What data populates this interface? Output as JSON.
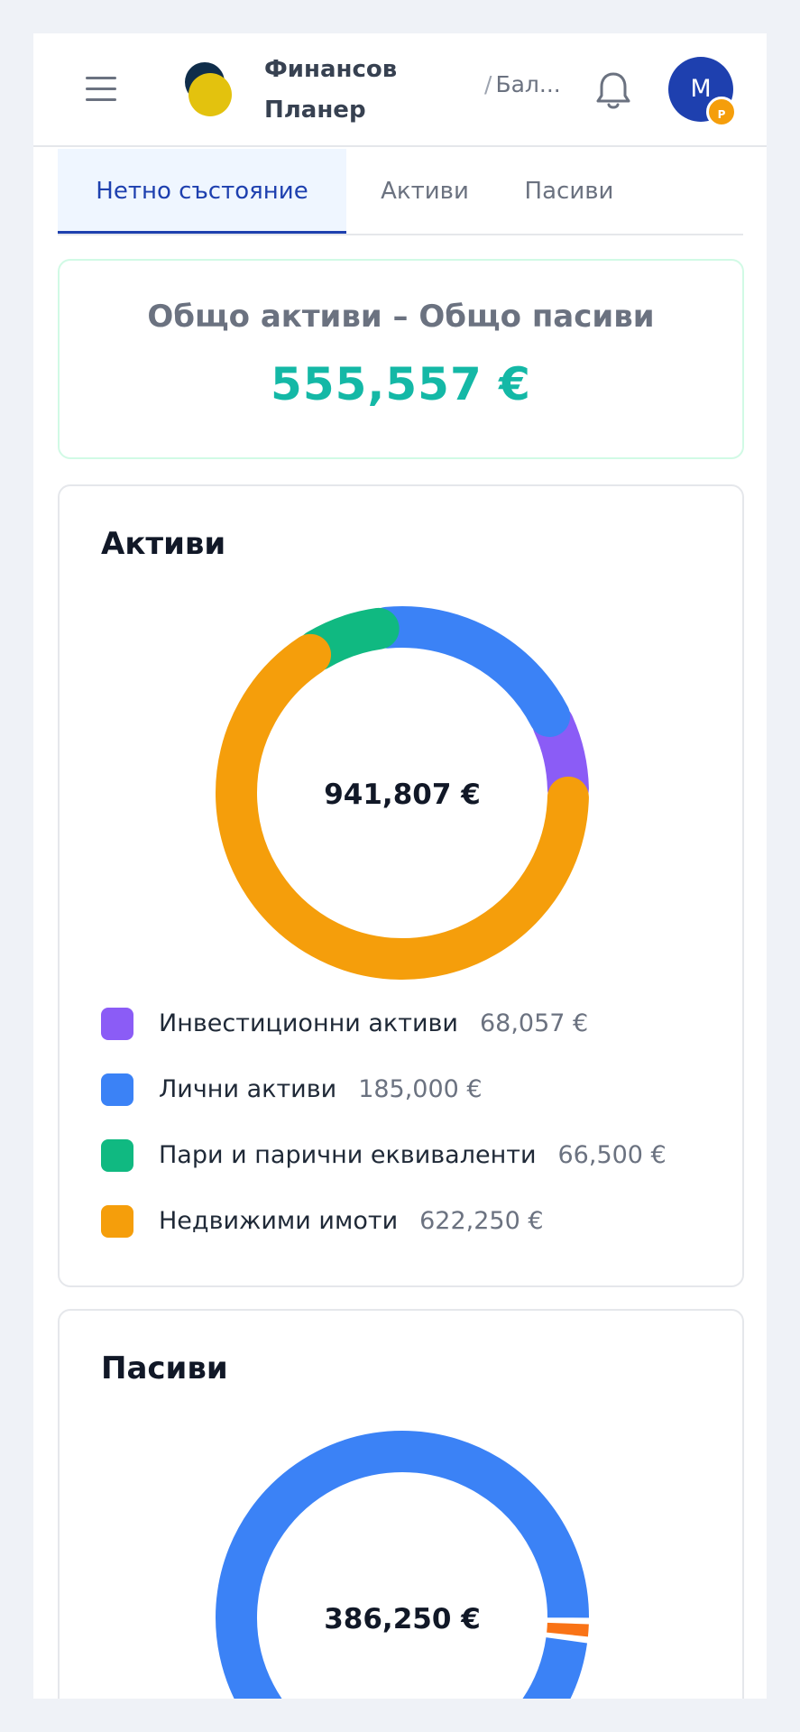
{
  "header": {
    "brand_line1": "Финансов",
    "brand_line2": "Планер",
    "breadcrumb": "Бал...",
    "avatar_initial": "M",
    "avatar_badge": "P",
    "icons": {
      "menu": "hamburger-menu-icon",
      "bell": "bell-icon"
    }
  },
  "tabs": [
    {
      "label": "Нетно състояние",
      "active": true
    },
    {
      "label": "Активи",
      "active": false
    },
    {
      "label": "Пасиви",
      "active": false
    }
  ],
  "net_worth": {
    "label": "Общо активи – Общо пасиви",
    "value": "555,557 €",
    "color": "#14b8a6"
  },
  "chart_data": [
    {
      "type": "pie",
      "title": "Активи",
      "center_label": "941,807 €",
      "series": [
        {
          "name": "Инвестиционни активи",
          "value": 68057,
          "value_label": "68,057 €",
          "color": "#8b5cf6"
        },
        {
          "name": "Лични активи",
          "value": 185000,
          "value_label": "185,000 €",
          "color": "#3b82f6"
        },
        {
          "name": "Пари и парични еквиваленти",
          "value": 66500,
          "value_label": "66,500 €",
          "color": "#10b981"
        },
        {
          "name": "Недвижими имоти",
          "value": 622250,
          "value_label": "622,250 €",
          "color": "#f59e0b"
        }
      ]
    },
    {
      "type": "pie",
      "title": "Пасиви",
      "center_label": "386,250 €",
      "series": [
        {
          "value": 380000,
          "color": "#3b82f6"
        },
        {
          "value": 6250,
          "color": "#f97316"
        }
      ]
    }
  ]
}
